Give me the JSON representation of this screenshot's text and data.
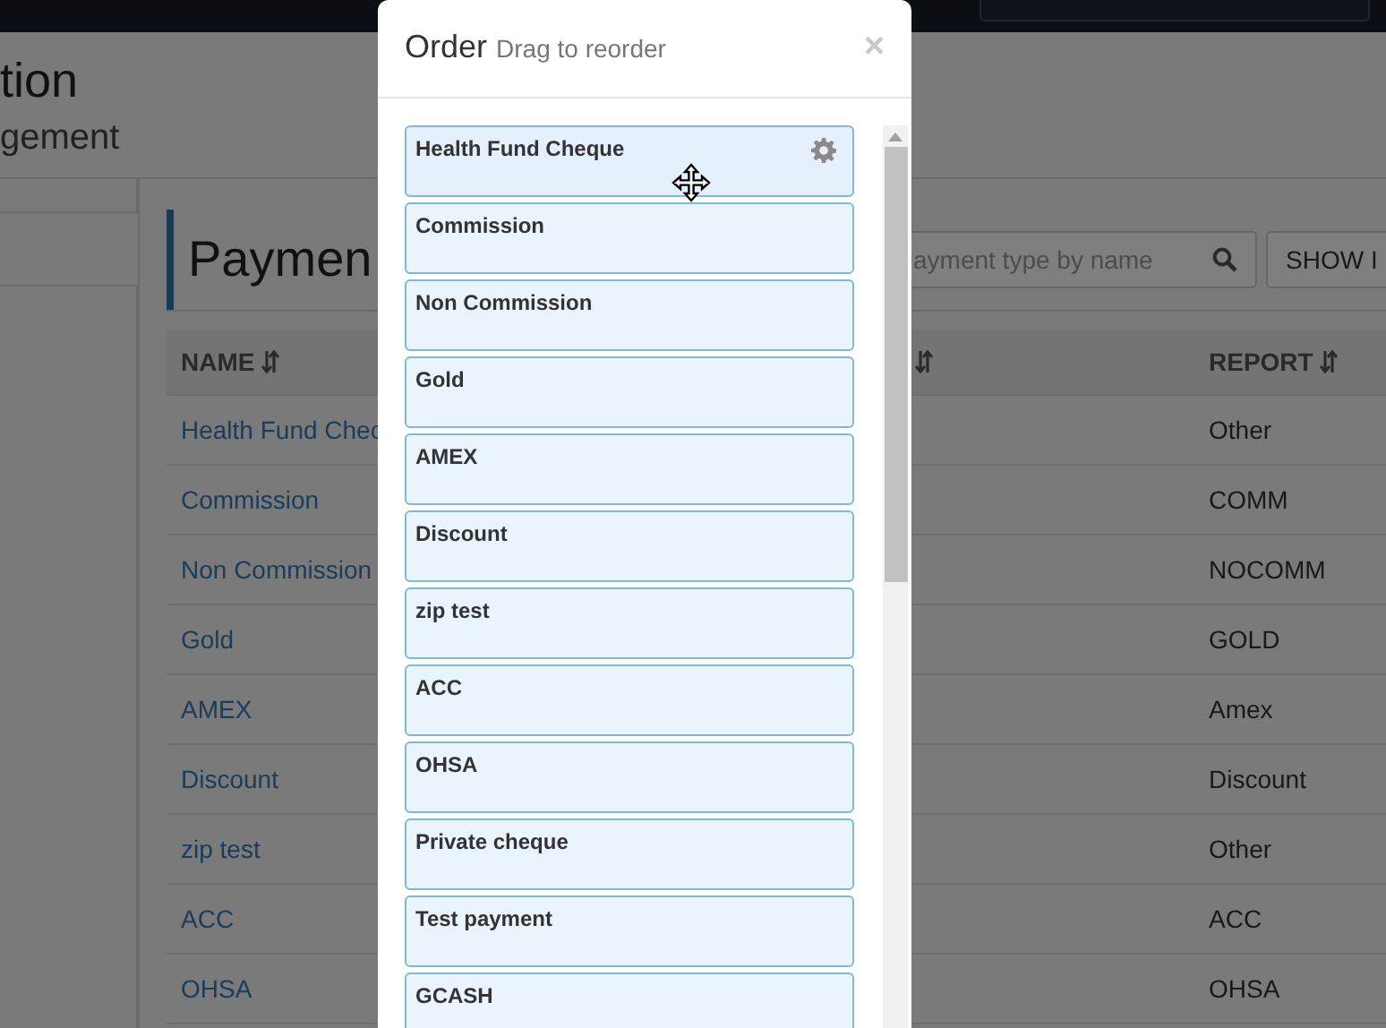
{
  "page": {
    "title": "tion",
    "subtitle": "gement",
    "heading": "Paymen",
    "search": {
      "placeholder": "ayment type by name"
    },
    "show_button": "SHOW I"
  },
  "table": {
    "columns": [
      {
        "label": "NAME",
        "sortable": true
      },
      {
        "sortable": true
      },
      {
        "label": "REPORT",
        "sortable": true
      }
    ],
    "rows": [
      {
        "name": "Health Fund Chec",
        "report": "Other"
      },
      {
        "name": "Commission",
        "report": "COMM"
      },
      {
        "name": "Non Commission",
        "report": "NOCOMM"
      },
      {
        "name": "Gold",
        "report": "GOLD"
      },
      {
        "name": "AMEX",
        "report": "Amex"
      },
      {
        "name": "Discount",
        "report": "Discount"
      },
      {
        "name": "zip test",
        "report": "Other"
      },
      {
        "name": "ACC",
        "report": "ACC"
      },
      {
        "name": "OHSA",
        "report": "OHSA"
      }
    ]
  },
  "modal": {
    "title": "Order",
    "hint": "Drag to reorder",
    "close": "×",
    "items": [
      {
        "label": "Health Fund Cheque",
        "hovered": true
      },
      {
        "label": "Commission",
        "hovered": false
      },
      {
        "label": "Non Commission",
        "hovered": false
      },
      {
        "label": "Gold",
        "hovered": false
      },
      {
        "label": "AMEX",
        "hovered": false
      },
      {
        "label": "Discount",
        "hovered": false
      },
      {
        "label": "zip test",
        "hovered": false
      },
      {
        "label": "ACC",
        "hovered": false
      },
      {
        "label": "OHSA",
        "hovered": false
      },
      {
        "label": "Private cheque",
        "hovered": false
      },
      {
        "label": "Test payment",
        "hovered": false
      },
      {
        "label": "GCASH",
        "hovered": false
      }
    ]
  }
}
